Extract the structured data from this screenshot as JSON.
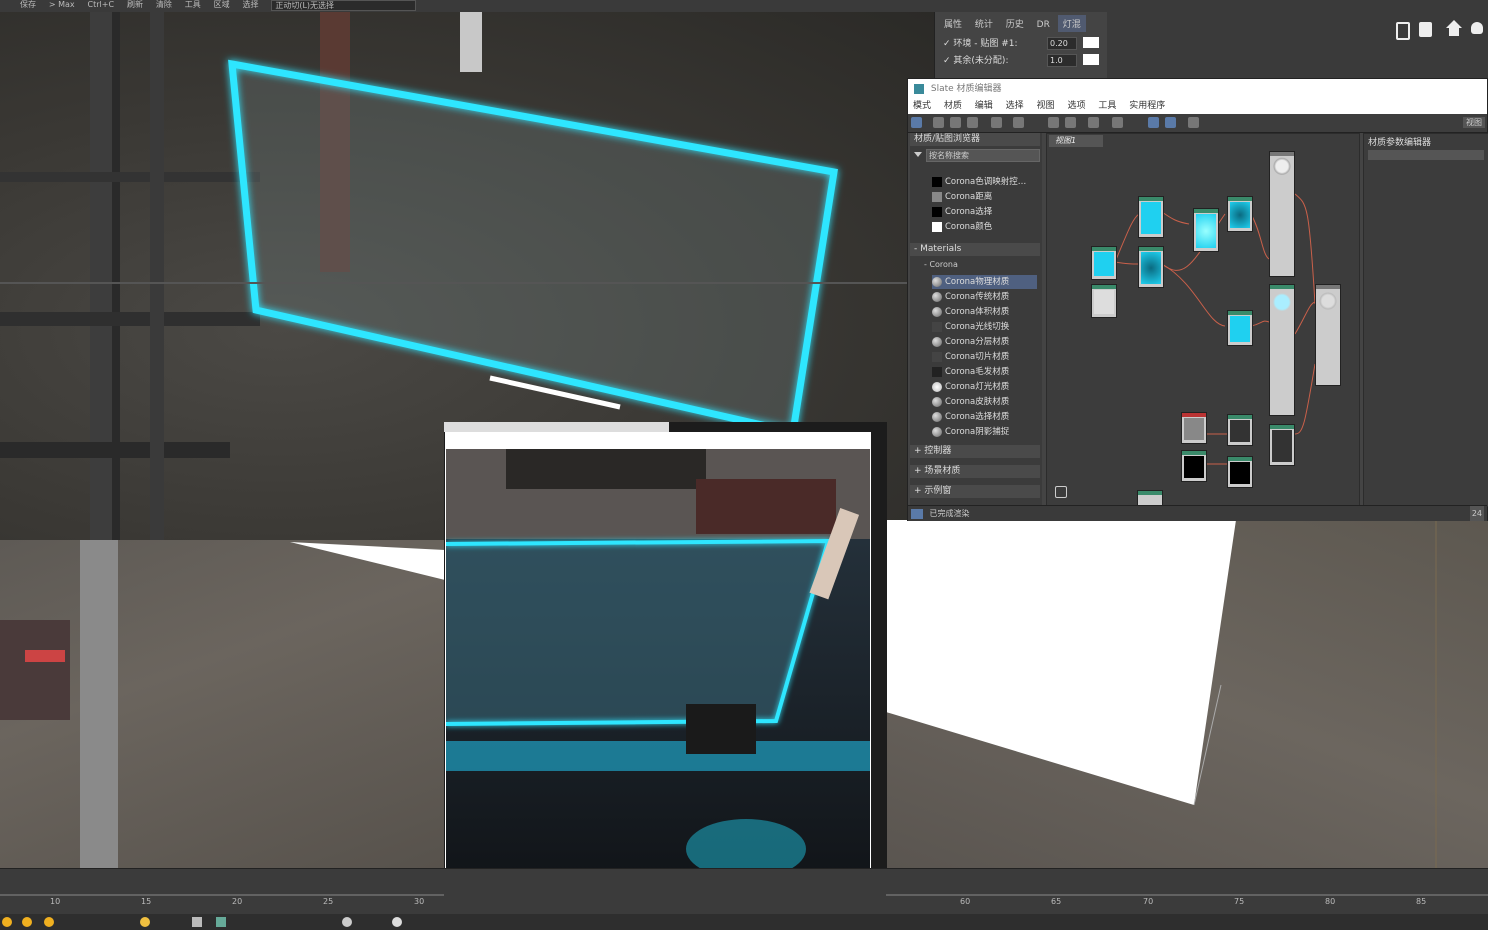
{
  "toolbar": {
    "items": [
      "保存",
      "> Max",
      "Ctrl+C",
      "刷新",
      "清除",
      "工具",
      "区域",
      "选择"
    ],
    "dropdown": "正动切(L)无选择"
  },
  "env_panel": {
    "tabs": [
      "属性",
      "统计",
      "历史",
      "DR",
      "灯混"
    ],
    "active_tab": 4,
    "row1_label": "环境 - 贴图 #1:",
    "row1_value": "0.20",
    "row2_label": "其余(未分配):",
    "row2_value": "1.0"
  },
  "slate": {
    "title": "Slate 材质编辑器",
    "menu": [
      "模式",
      "材质",
      "编辑",
      "选择",
      "视图",
      "选项",
      "工具",
      "实用程序"
    ],
    "right_tab": "视图",
    "browser_title": "材质/贴图浏览器",
    "search_placeholder": "按名称搜索",
    "maps": [
      "Corona色调映射控…",
      "Corona距离",
      "Corona选择",
      "Corona颜色"
    ],
    "materials_header": "Materials",
    "corona_header": "Corona",
    "materials": [
      "Corona物理材质",
      "Corona传统材质",
      "Corona体积材质",
      "Corona光线切换",
      "Corona分层材质",
      "Corona切片材质",
      "Corona毛发材质",
      "Corona灯光材质",
      "Corona皮肤材质",
      "Corona选择材质",
      "Corona阴影捕捉"
    ],
    "selected_material": 0,
    "sections": [
      "+ 控制器",
      "+ 场景材质",
      "+ 示例窗"
    ],
    "view_tab": "视图1",
    "param_title": "材质参数编辑器",
    "status": "已完成渲染",
    "status_right": "24"
  },
  "timeline": {
    "left_ticks": [
      "10",
      "15",
      "20",
      "25",
      "30"
    ],
    "right_ticks": [
      "60",
      "65",
      "70",
      "75",
      "80",
      "85"
    ]
  },
  "colors": {
    "glow": "#2fe6ff",
    "panel": "#444444",
    "node_cyan": "#1fd0f0"
  },
  "icons": [
    "home-icon",
    "render-icon",
    "teapot-icon",
    "script-icon"
  ]
}
